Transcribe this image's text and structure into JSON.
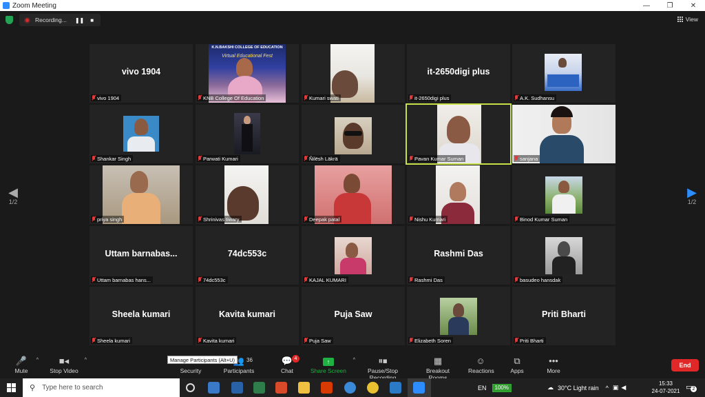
{
  "window": {
    "title": "Zoom Meeting",
    "minimize": "—",
    "restore": "❐",
    "close": "✕"
  },
  "recording": {
    "label": "Recording...",
    "pause": "❚❚",
    "stop": "■"
  },
  "view": {
    "label": "View"
  },
  "pager": {
    "prev_page": "1/2",
    "next_page": "1/2",
    "prev_arrow": "◀",
    "next_arrow": "▶"
  },
  "tiles": [
    {
      "name": "vivo 1904",
      "big": "vivo 1904"
    },
    {
      "name": "KNB College Of Education",
      "banner_line1": "K.N.BAKSHI COLLEGE OF EDUCATION",
      "banner_line2": "Virtual Educational Fest"
    },
    {
      "name": "Kumari swati"
    },
    {
      "name": "it-2650digi plus",
      "big": "it-2650digi plus"
    },
    {
      "name": "A.K. Sudhansu"
    },
    {
      "name": "Shankar Singh"
    },
    {
      "name": "Parwati Kumari"
    },
    {
      "name": "Ñilësh Läkrä"
    },
    {
      "name": "Pavan Kumar Suman"
    },
    {
      "name": "sanjana"
    },
    {
      "name": "priya singh"
    },
    {
      "name": "Shrinivas tiwary"
    },
    {
      "name": "Deepak patal"
    },
    {
      "name": "Nishu Kumari"
    },
    {
      "name": "Binod Kumar Suman"
    },
    {
      "name": "Uttam barnabas hans...",
      "big": "Uttam  barnabas..."
    },
    {
      "name": "74dc553c",
      "big": "74dc553c"
    },
    {
      "name": "KAJAL KUMARI"
    },
    {
      "name": "Rashmi Das",
      "big": "Rashmi Das"
    },
    {
      "name": "basudeo hansdak"
    },
    {
      "name": "Sheela kumari",
      "big": "Sheela kumari"
    },
    {
      "name": "Kavita kumari",
      "big": "Kavita kumari"
    },
    {
      "name": "Puja Saw",
      "big": "Puja Saw"
    },
    {
      "name": "Elizabeth Soren"
    },
    {
      "name": "Priti Bharti",
      "big": "Priti Bharti"
    }
  ],
  "toolbar": {
    "mute": "Mute",
    "stop_video": "Stop Video",
    "security": "Security",
    "participants": "Participants",
    "participants_count": "36",
    "tooltip": "Manage Participants (Alt+U)",
    "chat": "Chat",
    "chat_badge": "4",
    "share_screen": "Share Screen",
    "pause_recording": "Pause/Stop Recording",
    "breakout": "Breakout Rooms",
    "reactions": "Reactions",
    "apps": "Apps",
    "more": "More",
    "end": "End"
  },
  "taskbar": {
    "search_placeholder": "Type here to search",
    "lang": "EN",
    "battery": "100%",
    "weather": "30°C  Light rain",
    "time": "15:33",
    "date": "24-07-2021",
    "notifications": "2"
  },
  "colors": {
    "active_speaker": "#c8e24a",
    "end_button": "#e02828",
    "share": "#1fb141",
    "accent": "#2d8cff"
  }
}
